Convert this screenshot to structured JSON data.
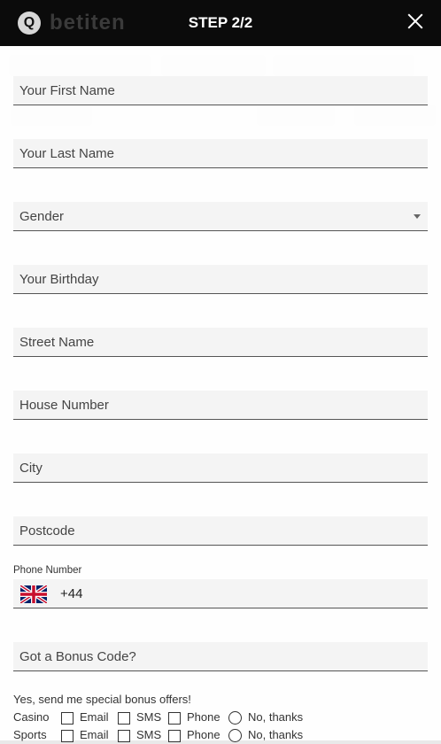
{
  "header": {
    "logo_mark": "Q",
    "logo_text": "betiten",
    "title": "STEP 2/2"
  },
  "form": {
    "first_name": "Your First Name",
    "last_name": "Your Last Name",
    "gender": "Gender",
    "birthday": "Your Birthday",
    "street": "Street Name",
    "house": "House Number",
    "city": "City",
    "postcode": "Postcode",
    "phone_label": "Phone Number",
    "phone_code": "+44",
    "bonus_code": "Got a Bonus Code?"
  },
  "offers": {
    "title": "Yes, send me special bonus offers!",
    "rows": [
      {
        "name": "Casino",
        "email": "Email",
        "sms": "SMS",
        "phone": "Phone",
        "decline": "No, thanks"
      },
      {
        "name": "Sports",
        "email": "Email",
        "sms": "SMS",
        "phone": "Phone",
        "decline": "No, thanks"
      }
    ]
  },
  "colors": {
    "header_bg": "#0b0b0b",
    "field_bg": "#f4f4f4",
    "field_border": "#555555"
  },
  "icons": {
    "close": "close-icon",
    "dropdown": "chevron-down-icon",
    "flag": "uk-flag-icon"
  }
}
